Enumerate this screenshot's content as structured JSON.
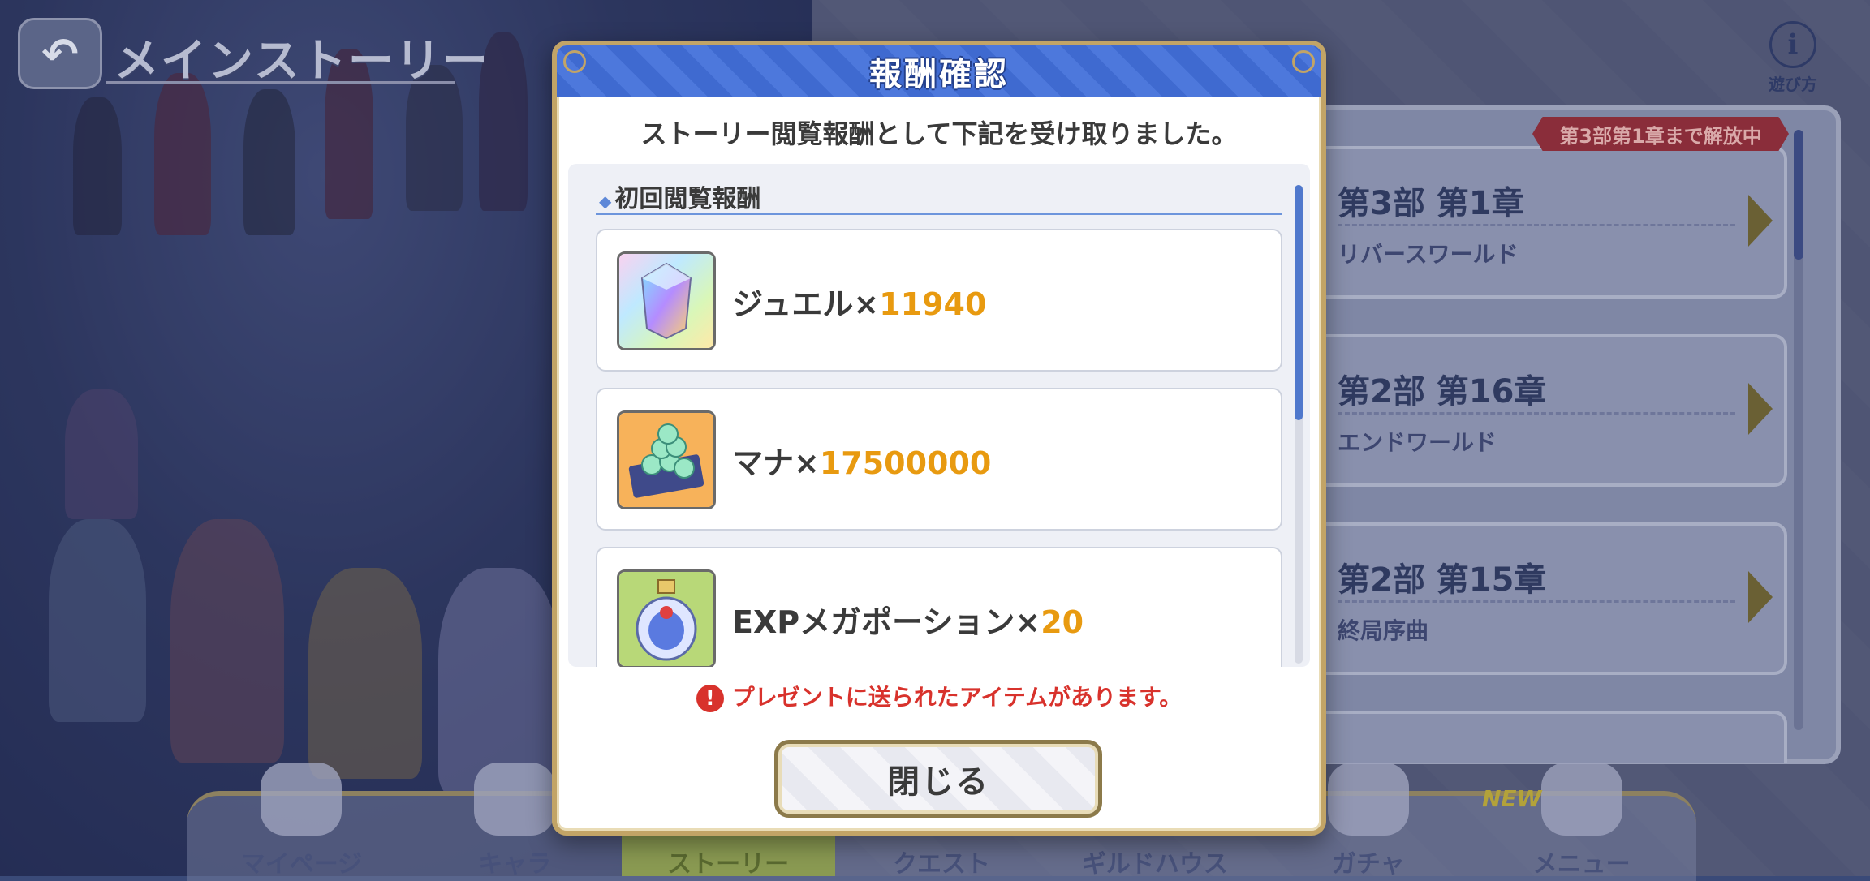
{
  "topbar": {
    "back_icon": "back-arrow-icon",
    "title": "メインストーリー",
    "help_label": "遊び方",
    "help_icon": "info-icon"
  },
  "chapters": {
    "banner": "第3部第1章まで解放中",
    "items": [
      {
        "title": "第3部 第1章",
        "subtitle": "リバースワールド"
      },
      {
        "title": "第2部 第16章",
        "subtitle": "エンドワールド"
      },
      {
        "title": "第2部 第15章",
        "subtitle": "終局序曲"
      }
    ]
  },
  "bottom_nav": {
    "items": [
      {
        "label": "マイページ"
      },
      {
        "label": "キャラ"
      },
      {
        "label": "ストーリー",
        "active": true
      },
      {
        "label": "クエスト"
      },
      {
        "label": "ギルドハウス"
      },
      {
        "label": "ガチャ"
      },
      {
        "label": "メニュー"
      }
    ],
    "new_badge": "NEW"
  },
  "modal": {
    "title": "報酬確認",
    "message": "ストーリー閲覧報酬として下記を受け取りました。",
    "section_title": "初回閲覧報酬",
    "rewards": [
      {
        "name": "ジュエル×",
        "qty": "11940",
        "icon": "jewel-icon"
      },
      {
        "name": "マナ×",
        "qty": "17500000",
        "icon": "mana-icon"
      },
      {
        "name": "EXPメガポーション×",
        "qty": "20",
        "icon": "exp-potion-icon"
      }
    ],
    "present_note": "プレゼントに送られたアイテムがあります。",
    "close_label": "閉じる"
  },
  "colors": {
    "accent_blue": "#3f6ad0",
    "qty_orange": "#e89a10",
    "warning_red": "#d8322c",
    "gold_border": "#c2a466"
  }
}
